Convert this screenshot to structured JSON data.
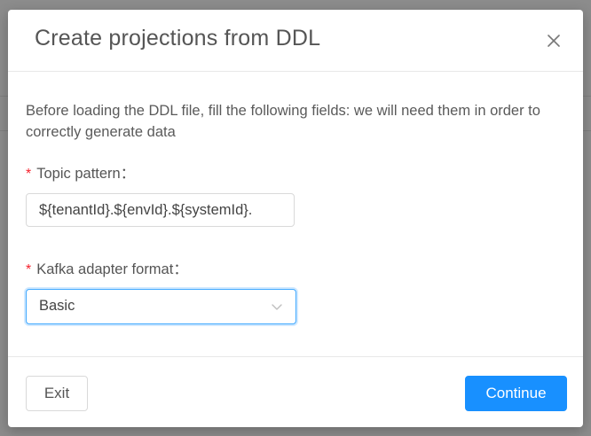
{
  "modal": {
    "title": "Create projections from DDL",
    "intro_text": "Before loading the DDL file, fill the following fields: we will need them in order to correctly generate data",
    "fields": {
      "topic_pattern": {
        "required_mark": "*",
        "label": "Topic pattern：",
        "value": "${tenantId}.${envId}.${systemId}."
      },
      "kafka_adapter_format": {
        "required_mark": "*",
        "label": "Kafka adapter format：",
        "selected_value": "Basic"
      }
    },
    "footer": {
      "exit_label": "Exit",
      "continue_label": "Continue"
    }
  },
  "colors": {
    "primary": "#1890ff",
    "required": "#f5222d",
    "overlay": "rgba(0,0,0,0.45)"
  },
  "icons": {
    "close": "close-icon",
    "select_arrow": "chevron-down-icon"
  }
}
